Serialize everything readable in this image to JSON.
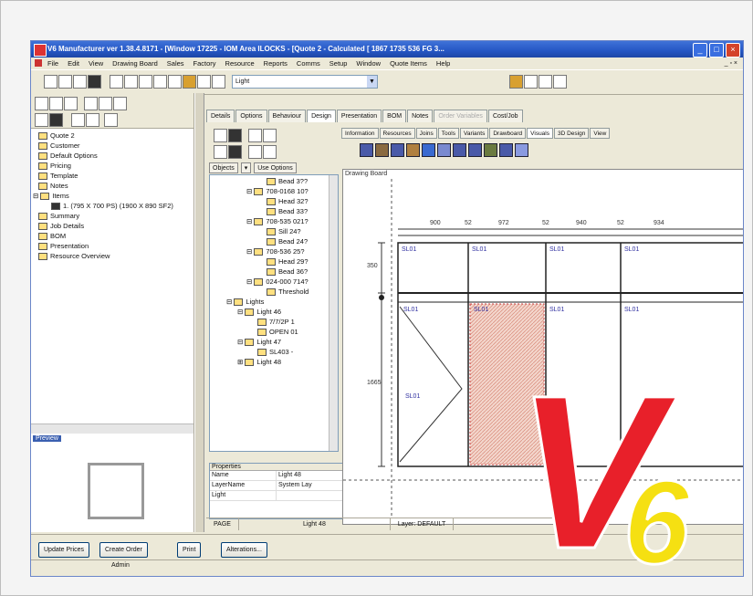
{
  "window": {
    "title": "V6 Manufacturer ver 1.38.4.8171 - [Window 17225 - IOM Area ILOCKS - [Quote 2 - Calculated [ 1867 1735 536 FG 3...",
    "buttons": [
      "_",
      "□",
      "×"
    ]
  },
  "menubar": {
    "items": [
      "File",
      "Edit",
      "View",
      "Drawing Board",
      "Sales",
      "Factory",
      "Resource",
      "Reports",
      "Comms",
      "Setup",
      "Window",
      "Quote Items",
      "Help"
    ],
    "mdi_controls": "_ ▫ ×"
  },
  "toolbar": {
    "combo_value": "Light"
  },
  "left_tree": {
    "items": [
      "Quote 2",
      "Customer",
      "Default Options",
      "Pricing",
      "Template",
      "Notes",
      "Items",
      "1. (795 X 700 PS) (1900 X 890 SF2)",
      "Summary",
      "Job Details",
      "BOM",
      "Presentation",
      "Resource Overview"
    ]
  },
  "left_panel_title": "Preview",
  "tabs": {
    "main": [
      "Details",
      "Options",
      "Behaviour",
      "Design",
      "Presentation",
      "BOM",
      "Notes",
      "Order Variables",
      "Cost/Job"
    ],
    "sub": [
      "Information",
      "Resources",
      "Joins",
      "Tools",
      "Variants",
      "Drawboard",
      "Visuals",
      "3D Design",
      "View"
    ]
  },
  "filter": {
    "label": "Objects",
    "options": "Use Options"
  },
  "mid_tree": {
    "items": [
      "Bead 3??",
      "708-0168 10?",
      "Head 32?",
      "Bead 33?",
      "708-535 021?",
      "Sill 24?",
      "Bead 24?",
      "708-536 25?",
      "Head 29?",
      "Bead 36?",
      "024-000 714?",
      "Threshold",
      "Lights",
      "Light 46",
      "7/7/2P 1",
      "OPEN 01",
      "Light 47",
      "SL403 -",
      "Light 48"
    ]
  },
  "properties": {
    "header": "Properties",
    "rows": [
      {
        "name": "Name",
        "value": "Light 48"
      },
      {
        "name": "LayerName",
        "value": "System Lay"
      },
      {
        "name": "Light",
        "value": ""
      }
    ]
  },
  "drawing": {
    "title": "Drawing Board",
    "top_dims": [
      "900",
      "52",
      "972",
      "52",
      "940",
      "52",
      "934"
    ],
    "left_dims": [
      "350",
      "1665"
    ],
    "labels": [
      "SL01",
      "SL01",
      "SL01",
      "SL01",
      "SL01",
      "SL01",
      "SL01",
      "SL01",
      "SL01"
    ]
  },
  "statusbar": {
    "page": "PAGE",
    "item": "Light 48",
    "layer": "Layer: DEFAULT"
  },
  "bottom_buttons": [
    "Update Prices",
    "Create Order",
    "Print",
    "Alterations..."
  ],
  "user": "Admin",
  "logo": {
    "letter": "V",
    "number": "6",
    "color_v": "#e8202a",
    "color_num": "#f5e012"
  }
}
